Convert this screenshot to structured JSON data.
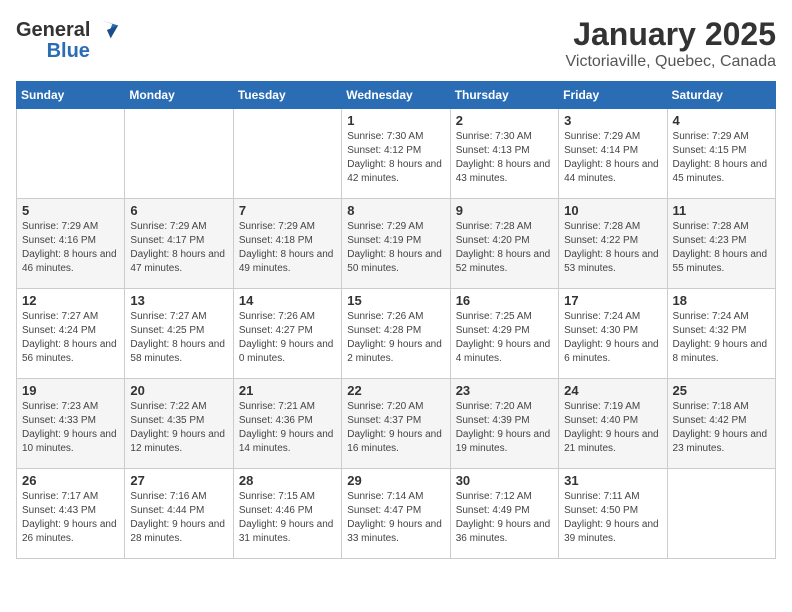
{
  "logo": {
    "general": "General",
    "blue": "Blue"
  },
  "header": {
    "month": "January 2025",
    "location": "Victoriaville, Quebec, Canada"
  },
  "weekdays": [
    "Sunday",
    "Monday",
    "Tuesday",
    "Wednesday",
    "Thursday",
    "Friday",
    "Saturday"
  ],
  "weeks": [
    [
      {
        "day": "",
        "info": ""
      },
      {
        "day": "",
        "info": ""
      },
      {
        "day": "",
        "info": ""
      },
      {
        "day": "1",
        "info": "Sunrise: 7:30 AM\nSunset: 4:12 PM\nDaylight: 8 hours and 42 minutes."
      },
      {
        "day": "2",
        "info": "Sunrise: 7:30 AM\nSunset: 4:13 PM\nDaylight: 8 hours and 43 minutes."
      },
      {
        "day": "3",
        "info": "Sunrise: 7:29 AM\nSunset: 4:14 PM\nDaylight: 8 hours and 44 minutes."
      },
      {
        "day": "4",
        "info": "Sunrise: 7:29 AM\nSunset: 4:15 PM\nDaylight: 8 hours and 45 minutes."
      }
    ],
    [
      {
        "day": "5",
        "info": "Sunrise: 7:29 AM\nSunset: 4:16 PM\nDaylight: 8 hours and 46 minutes."
      },
      {
        "day": "6",
        "info": "Sunrise: 7:29 AM\nSunset: 4:17 PM\nDaylight: 8 hours and 47 minutes."
      },
      {
        "day": "7",
        "info": "Sunrise: 7:29 AM\nSunset: 4:18 PM\nDaylight: 8 hours and 49 minutes."
      },
      {
        "day": "8",
        "info": "Sunrise: 7:29 AM\nSunset: 4:19 PM\nDaylight: 8 hours and 50 minutes."
      },
      {
        "day": "9",
        "info": "Sunrise: 7:28 AM\nSunset: 4:20 PM\nDaylight: 8 hours and 52 minutes."
      },
      {
        "day": "10",
        "info": "Sunrise: 7:28 AM\nSunset: 4:22 PM\nDaylight: 8 hours and 53 minutes."
      },
      {
        "day": "11",
        "info": "Sunrise: 7:28 AM\nSunset: 4:23 PM\nDaylight: 8 hours and 55 minutes."
      }
    ],
    [
      {
        "day": "12",
        "info": "Sunrise: 7:27 AM\nSunset: 4:24 PM\nDaylight: 8 hours and 56 minutes."
      },
      {
        "day": "13",
        "info": "Sunrise: 7:27 AM\nSunset: 4:25 PM\nDaylight: 8 hours and 58 minutes."
      },
      {
        "day": "14",
        "info": "Sunrise: 7:26 AM\nSunset: 4:27 PM\nDaylight: 9 hours and 0 minutes."
      },
      {
        "day": "15",
        "info": "Sunrise: 7:26 AM\nSunset: 4:28 PM\nDaylight: 9 hours and 2 minutes."
      },
      {
        "day": "16",
        "info": "Sunrise: 7:25 AM\nSunset: 4:29 PM\nDaylight: 9 hours and 4 minutes."
      },
      {
        "day": "17",
        "info": "Sunrise: 7:24 AM\nSunset: 4:30 PM\nDaylight: 9 hours and 6 minutes."
      },
      {
        "day": "18",
        "info": "Sunrise: 7:24 AM\nSunset: 4:32 PM\nDaylight: 9 hours and 8 minutes."
      }
    ],
    [
      {
        "day": "19",
        "info": "Sunrise: 7:23 AM\nSunset: 4:33 PM\nDaylight: 9 hours and 10 minutes."
      },
      {
        "day": "20",
        "info": "Sunrise: 7:22 AM\nSunset: 4:35 PM\nDaylight: 9 hours and 12 minutes."
      },
      {
        "day": "21",
        "info": "Sunrise: 7:21 AM\nSunset: 4:36 PM\nDaylight: 9 hours and 14 minutes."
      },
      {
        "day": "22",
        "info": "Sunrise: 7:20 AM\nSunset: 4:37 PM\nDaylight: 9 hours and 16 minutes."
      },
      {
        "day": "23",
        "info": "Sunrise: 7:20 AM\nSunset: 4:39 PM\nDaylight: 9 hours and 19 minutes."
      },
      {
        "day": "24",
        "info": "Sunrise: 7:19 AM\nSunset: 4:40 PM\nDaylight: 9 hours and 21 minutes."
      },
      {
        "day": "25",
        "info": "Sunrise: 7:18 AM\nSunset: 4:42 PM\nDaylight: 9 hours and 23 minutes."
      }
    ],
    [
      {
        "day": "26",
        "info": "Sunrise: 7:17 AM\nSunset: 4:43 PM\nDaylight: 9 hours and 26 minutes."
      },
      {
        "day": "27",
        "info": "Sunrise: 7:16 AM\nSunset: 4:44 PM\nDaylight: 9 hours and 28 minutes."
      },
      {
        "day": "28",
        "info": "Sunrise: 7:15 AM\nSunset: 4:46 PM\nDaylight: 9 hours and 31 minutes."
      },
      {
        "day": "29",
        "info": "Sunrise: 7:14 AM\nSunset: 4:47 PM\nDaylight: 9 hours and 33 minutes."
      },
      {
        "day": "30",
        "info": "Sunrise: 7:12 AM\nSunset: 4:49 PM\nDaylight: 9 hours and 36 minutes."
      },
      {
        "day": "31",
        "info": "Sunrise: 7:11 AM\nSunset: 4:50 PM\nDaylight: 9 hours and 39 minutes."
      },
      {
        "day": "",
        "info": ""
      }
    ]
  ]
}
